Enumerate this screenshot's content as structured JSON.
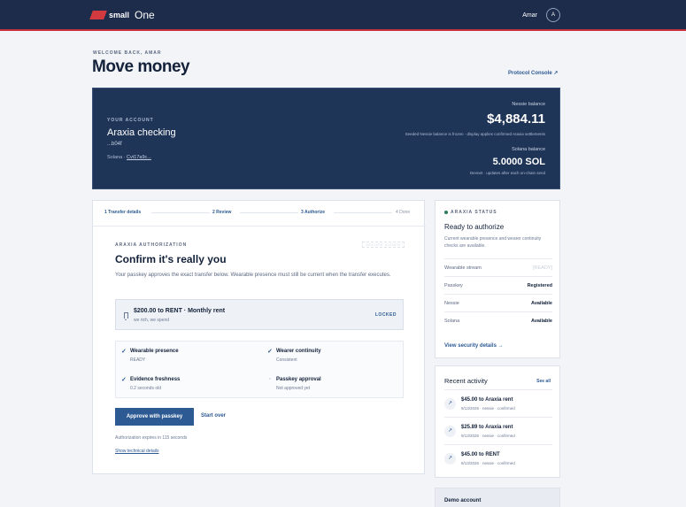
{
  "header": {
    "logo_small": "small",
    "logo_one": "One",
    "user_name": "Amar",
    "avatar_initial": "A"
  },
  "page": {
    "welcome": "WELCOME BACK, AMAR",
    "title": "Move money",
    "console_link": "Protocol Console ↗"
  },
  "account": {
    "label": "YOUR ACCOUNT",
    "name": "Araxia checking",
    "number": "...b04f",
    "solana_label": "Solana · ",
    "solana_address": "Cvt17a9c...",
    "nessie_label": "Nessie balance",
    "nessie_amount": "$4,884.11",
    "nessie_note": "Seeded Nessie balance is frozen · display applies confirmed Araxia settlements",
    "solana_balance_label": "Solana balance",
    "solana_amount": "5.0000 SOL",
    "solana_note": "Devnet · updates after each on-chain send"
  },
  "steps": [
    {
      "label": "1  Transfer details"
    },
    {
      "label": "2  Review"
    },
    {
      "label": "3  Authorize"
    },
    {
      "label": "4  Done"
    }
  ],
  "authorization": {
    "label": "ARAXIA AUTHORIZATION",
    "badge": "SECURE SIGNER",
    "title": "Confirm it's really you",
    "description": "Your passkey approves the exact transfer below. Wearable presence must still be current when the transfer executes.",
    "transfer_main": "$200.00 to RENT · Monthly rent",
    "transfer_sub": "we rich, we spend",
    "locked": "LOCKED",
    "checks": [
      {
        "title": "Wearable presence",
        "sub": "READY"
      },
      {
        "title": "Wearer continuity",
        "sub": "Consistent"
      },
      {
        "title": "Evidence freshness",
        "sub": "0.2 seconds old"
      },
      {
        "title": "Passkey approval",
        "sub": "Not approved yet"
      }
    ],
    "approve_button": "Approve with passkey",
    "start_over": "Start over",
    "expires": "Authorization expires in 115 seconds",
    "tech_details": "Show technical details"
  },
  "status": {
    "label": "ARAXIA STATUS",
    "title": "Ready to authorize",
    "description": "Current wearable presence and wearer continuity checks are available.",
    "rows": [
      {
        "key": "Wearable stream",
        "value": "[READY]"
      },
      {
        "key": "Passkey",
        "value": "Registered"
      },
      {
        "key": "Nessie",
        "value": "Available"
      },
      {
        "key": "Solana",
        "value": "Available"
      }
    ],
    "link": "View security details →"
  },
  "activity": {
    "title": "Recent activity",
    "see_all": "See all",
    "items": [
      {
        "main": "$45.00 to Araxia rent",
        "sub": "9/13/2026 · nessie · confirmed"
      },
      {
        "main": "$25.89 to Araxia rent",
        "sub": "9/13/2026 · nessie · confirmed"
      },
      {
        "main": "$45.00 to RENT",
        "sub": "9/13/2026 · nessie · confirmed"
      }
    ]
  },
  "demo": {
    "label": "Demo account"
  },
  "colors": {
    "navy": "#1c2c4a",
    "accent": "#2d5a93",
    "brand_red": "#d33a3f",
    "status_green": "#2f7a5a"
  }
}
